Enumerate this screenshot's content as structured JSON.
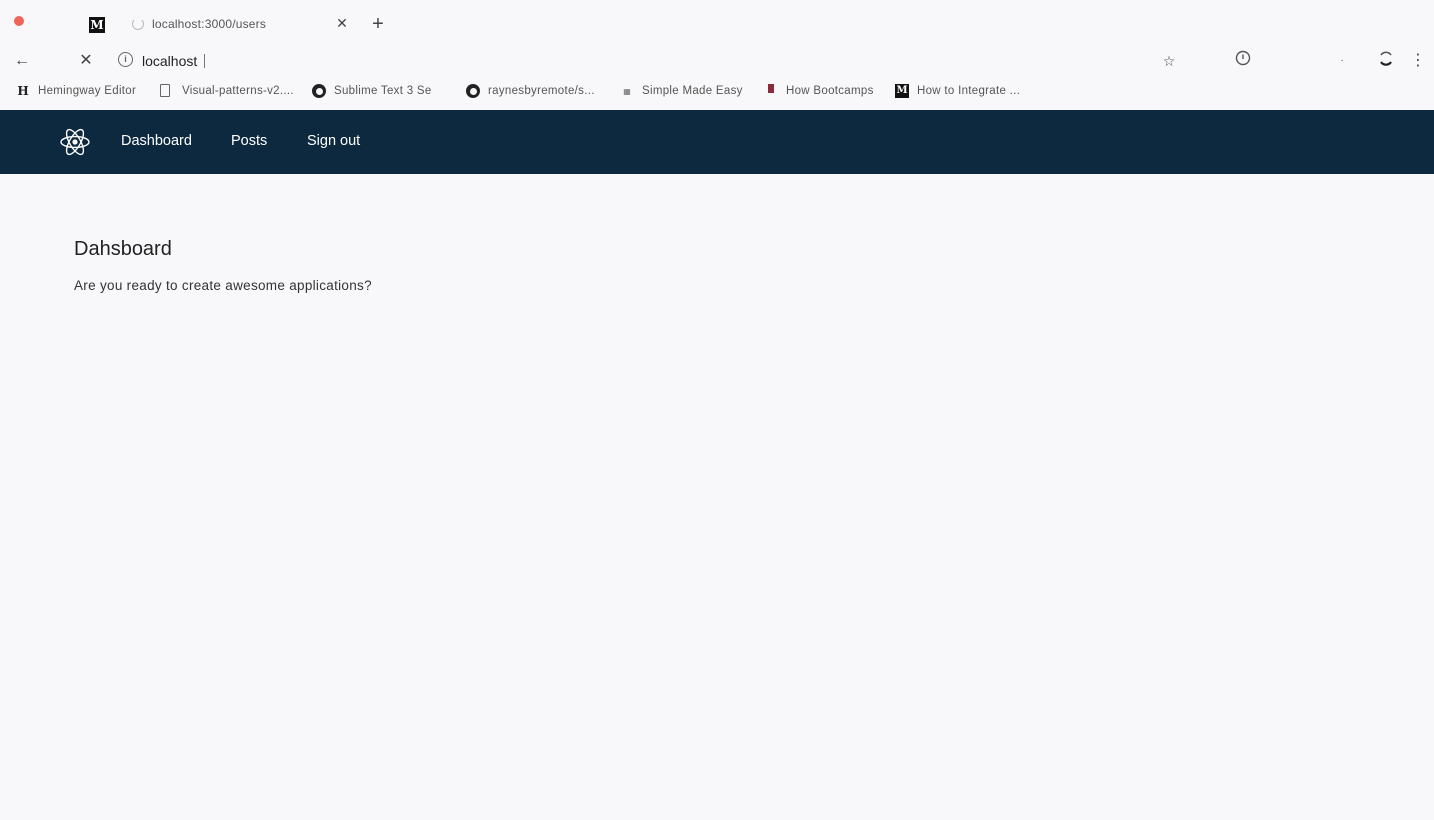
{
  "tab": {
    "favicon": "M",
    "title": "localhost:3000/users"
  },
  "address_bar": {
    "url": "localhost"
  },
  "bookmarks": [
    {
      "icon": "H",
      "label": "Hemingway Editor"
    },
    {
      "icon": "doc-icon",
      "label": "Visual-patterns-v2...."
    },
    {
      "icon": "github-icon",
      "label": "Sublime Text 3 Se"
    },
    {
      "icon": "github-icon",
      "label": "raynesbyremote/s..."
    },
    {
      "icon": "simple-made-easy-icon",
      "label": "Simple Made Easy"
    },
    {
      "icon": "bootcamps-icon",
      "label": "How Bootcamps"
    },
    {
      "icon": "M",
      "label": "How to Integrate ..."
    }
  ],
  "navbar": {
    "background": "#0c2940",
    "links": [
      "Dashboard",
      "Posts",
      "Sign out"
    ]
  },
  "page": {
    "title": "Dahsboard",
    "subtitle": "Are you ready to create awesome applications?"
  }
}
